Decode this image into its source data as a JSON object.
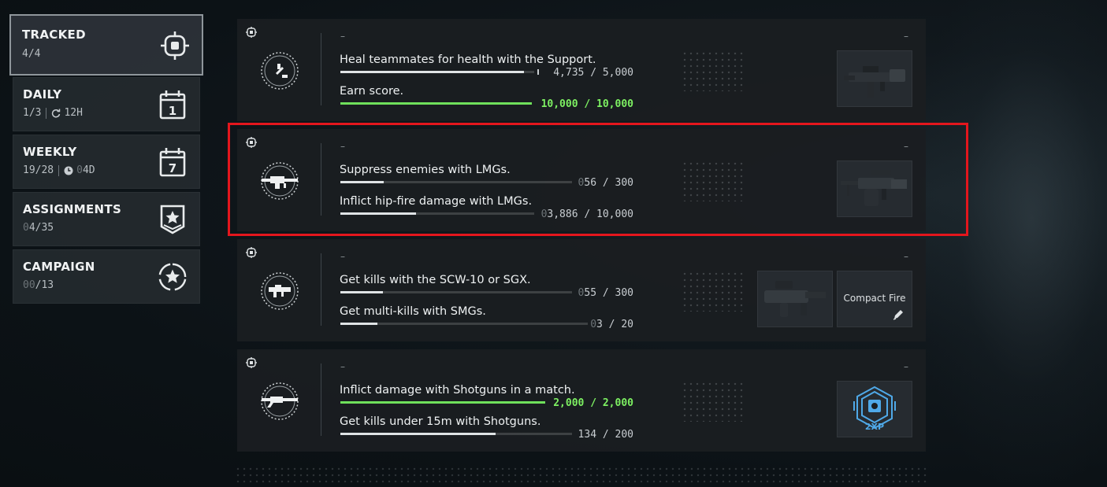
{
  "sidebar": {
    "tabs": [
      {
        "title": "TRACKED",
        "progress": "4/4",
        "icon": "crosshair-icon",
        "active": true
      },
      {
        "title": "DAILY",
        "progress": "1/3",
        "timer": "12H",
        "icon": "calendar-1-icon",
        "badge": "1"
      },
      {
        "title": "WEEKLY",
        "progress_done": "19",
        "progress_total": "/28",
        "timer": "04D",
        "timer_dim": "0",
        "timer_main": "4D",
        "icon": "calendar-7-icon",
        "badge": "7"
      },
      {
        "title": "ASSIGNMENTS",
        "progress_dim": "0",
        "progress_main": "4/35",
        "icon": "star-shield-icon"
      },
      {
        "title": "CAMPAIGN",
        "progress_dim": "00",
        "progress_main": "/13",
        "icon": "star-circle-icon"
      }
    ]
  },
  "cards": [
    {
      "category_icon": "support-icon",
      "dash_left": "–",
      "dash_right": "–",
      "challenges": [
        {
          "label": "Heal teammates for health with the Support.",
          "current": "4,735",
          "total": "5,000",
          "progress": 0.947,
          "complete": false
        },
        {
          "label": "Earn score.",
          "current": "10,000",
          "total": "10,000",
          "progress": 1.0,
          "complete": true
        }
      ],
      "reward": {
        "type": "weapon",
        "icon": "smg-weapon-image"
      }
    },
    {
      "category_icon": "lmg-icon",
      "dash_left": "–",
      "dash_right": "–",
      "challenges": [
        {
          "label": "Suppress enemies with LMGs.",
          "current_dim": "0",
          "current": "56",
          "total": "300",
          "progress": 0.187,
          "complete": false
        },
        {
          "label": "Inflict hip-fire damage with LMGs.",
          "current_dim": "0",
          "current": "3,886",
          "total": "10,000",
          "progress": 0.389,
          "complete": false
        }
      ],
      "reward": {
        "type": "weapon",
        "icon": "lmg-weapon-image"
      }
    },
    {
      "category_icon": "smg-icon",
      "dash_left": "–",
      "dash_right": "–",
      "challenges": [
        {
          "label": "Get kills with the SCW-10 or SGX.",
          "current_dim": "0",
          "current": "55",
          "total": "300",
          "progress": 0.183,
          "complete": false
        },
        {
          "label": "Get multi-kills with SMGs.",
          "current_dim": "0",
          "current": "3",
          "total": "20",
          "progress": 0.15,
          "complete": false
        }
      ],
      "reward": {
        "type": "weapon",
        "icon": "smg-weapon-image",
        "attachment_label": "Compact Fire",
        "attachment_icon": "pen-icon"
      }
    },
    {
      "category_icon": "shotgun-icon",
      "dash_left": "–",
      "dash_right": "–",
      "challenges": [
        {
          "label": "Inflict damage with Shotguns in a match.",
          "current": "2,000",
          "total": "2,000",
          "progress": 1.0,
          "complete": true
        },
        {
          "label": "Get kills under 15m with Shotguns.",
          "current": "134",
          "total": "200",
          "progress": 0.67,
          "complete": false
        }
      ],
      "reward": {
        "type": "booster",
        "icon": "2xp-booster-icon",
        "label": "2XP"
      }
    }
  ],
  "highlight_card_index": 1
}
